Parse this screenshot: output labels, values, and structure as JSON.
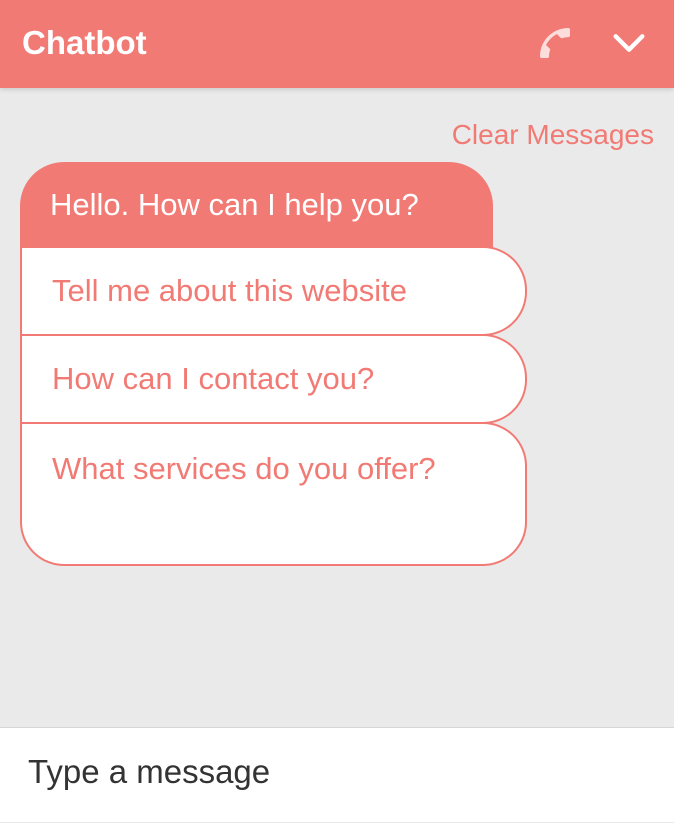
{
  "header": {
    "title": "Chatbot",
    "call_icon": "phone-icon",
    "collapse_icon": "chevron-down-icon"
  },
  "toolbar": {
    "clear_label": "Clear Messages"
  },
  "conversation": {
    "bot_message": "Hello. How can I help you?",
    "options": [
      "Tell me about this website",
      "How can I contact you?",
      "What services do you offer?"
    ]
  },
  "composer": {
    "placeholder": "Type a message"
  },
  "colors": {
    "accent": "#f27a74",
    "background": "#eaeaea",
    "surface": "#ffffff"
  }
}
